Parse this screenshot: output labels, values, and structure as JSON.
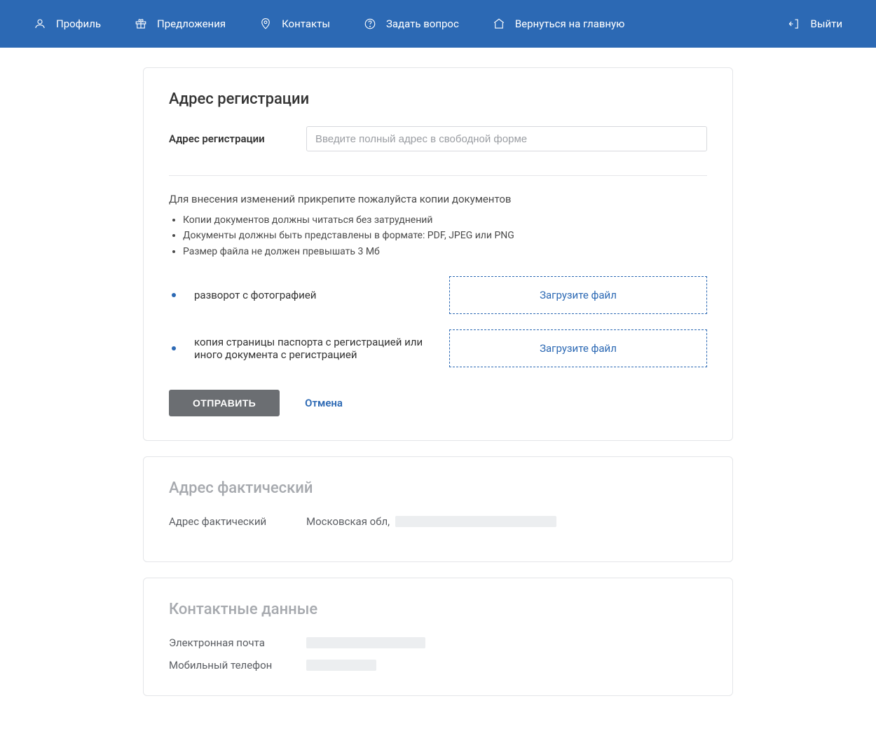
{
  "nav": {
    "profile": "Профиль",
    "offers": "Предложения",
    "contacts": "Контакты",
    "ask": "Задать вопрос",
    "home": "Вернуться на главную",
    "logout": "Выйти"
  },
  "reg": {
    "title": "Адрес регистрации",
    "label": "Адрес регистрации",
    "placeholder": "Введите полный адрес в свободной форме",
    "instructions_head": "Для внесения изменений прикрепите пожалуйста копии документов",
    "instructions": [
      "Копии документов должны читаться без затруднений",
      "Документы должны быть представлены в формате: PDF, JPEG или PNG",
      "Размер файла не должен превышать 3 Мб"
    ],
    "uploads": [
      "разворот с фотографией",
      "копия страницы паспорта с регистрацией или иного документа с регистрацией"
    ],
    "upload_button": "Загрузите файл",
    "submit": "ОТПРАВИТЬ",
    "cancel": "Отмена"
  },
  "actual": {
    "title": "Адрес фактический",
    "label": "Адрес фактический",
    "value_prefix": "Московская обл,"
  },
  "contacts": {
    "title": "Контактные данные",
    "email_label": "Электронная почта",
    "phone_label": "Мобильный телефон"
  }
}
